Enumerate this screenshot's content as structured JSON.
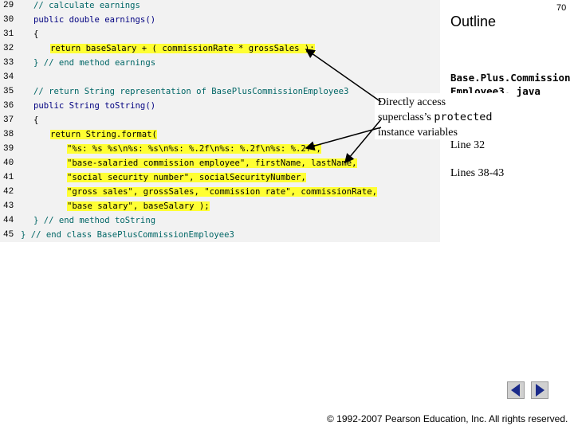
{
  "slide": {
    "page_number": "70",
    "outline_title": "Outline",
    "filename_line1": "Base.Plus.Commission",
    "filename_line2": "Employee3. java",
    "side_note_1": "Line 32",
    "side_note_2": "Lines 38-43",
    "callout_line1": "Directly access",
    "callout_line2_prefix": "superclass’s ",
    "callout_line2_code": "protected",
    "callout_line3": "instance variables",
    "copyright": "© 1992-2007 Pearson Education, Inc. All rights reserved."
  },
  "code": {
    "lines": [
      {
        "num": "29",
        "text": "// calculate earnings"
      },
      {
        "num": "30",
        "text": "public double earnings()"
      },
      {
        "num": "31",
        "text": "{"
      },
      {
        "num": "32",
        "text": "return baseSalary + ( commissionRate * grossSales );"
      },
      {
        "num": "33",
        "text": "} // end method earnings"
      },
      {
        "num": "34",
        "text": ""
      },
      {
        "num": "35",
        "text": "// return String representation of BasePlusCommissionEmployee3"
      },
      {
        "num": "36",
        "text": "public String toString()"
      },
      {
        "num": "37",
        "text": "{"
      },
      {
        "num": "38",
        "text": "return String.format("
      },
      {
        "num": "39",
        "text": "\"%s: %s %s\\n%s: %s\\n%s: %.2f\\n%s: %.2f\\n%s: %.2f\","
      },
      {
        "num": "40",
        "text": "\"base-salaried commission employee\", firstName, lastName,"
      },
      {
        "num": "41",
        "text": "\"social security number\", socialSecurityNumber,"
      },
      {
        "num": "42",
        "text": "\"gross sales\", grossSales, \"commission rate\", commissionRate,"
      },
      {
        "num": "43",
        "text": "\"base salary\", baseSalary );"
      },
      {
        "num": "44",
        "text": "} // end method toString"
      },
      {
        "num": "45",
        "text": "} // end class BasePlusCommissionEmployee3"
      }
    ]
  },
  "nav": {
    "prev_icon": "triangle-left-icon",
    "next_icon": "triangle-right-icon"
  }
}
